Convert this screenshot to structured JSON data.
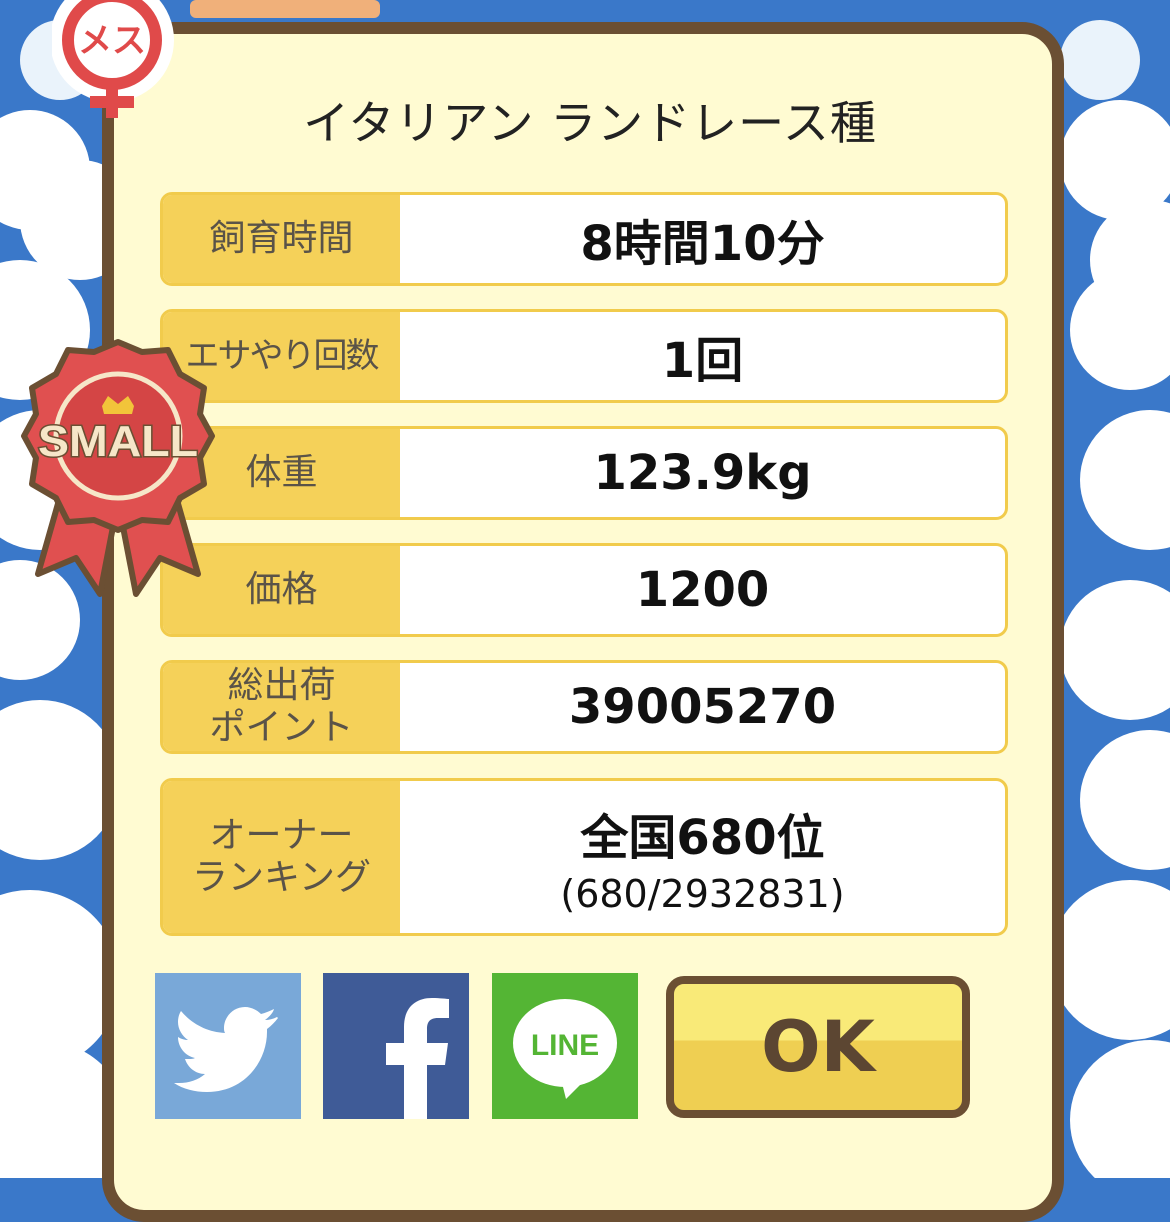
{
  "dialog": {
    "title": "イタリアン ランドレース種",
    "gender_badge": "メス",
    "size_badge": "SMALL",
    "ok_label": "OK"
  },
  "stats": [
    {
      "label": "飼育時間",
      "value": "8時間10分"
    },
    {
      "label": "エサやり回数",
      "value": "1回"
    },
    {
      "label": "体重",
      "value": "123.9kg"
    },
    {
      "label": "価格",
      "value": "1200"
    },
    {
      "label_line1": "総出荷",
      "label_line2": "ポイント",
      "value": "39005270"
    },
    {
      "label_line1": "オーナー",
      "label_line2": "ランキング",
      "value": "全国680位",
      "sub": "(680/2932831)"
    }
  ],
  "share": {
    "twitter": "twitter-icon",
    "facebook": "facebook-icon",
    "line": "LINE"
  },
  "colors": {
    "panel_bg": "#fffbd2",
    "panel_border": "#6b4f33",
    "label_bg": "#f5d159",
    "twitter": "#79a8d8",
    "facebook": "#3f5b97",
    "line": "#54b534",
    "sky": "#3a78c9"
  }
}
